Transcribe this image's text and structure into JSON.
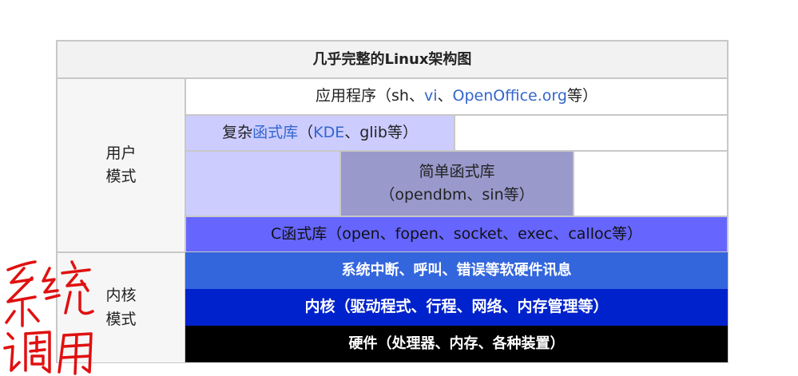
{
  "title": "几乎完整的Linux架构图",
  "user_mode": {
    "line1": "用户",
    "line2": "模式"
  },
  "kernel_mode": {
    "line1": "内核",
    "line2": "模式"
  },
  "apps": {
    "prefix": "应用程序（sh、",
    "vi": "vi",
    "sep": "、",
    "openoffice": "OpenOffice.org",
    "suffix": "等）"
  },
  "complex_lib": {
    "prefix": "复杂",
    "link": "函式库",
    "mid": "（",
    "kde": "KDE",
    "suffix": "、glib等）"
  },
  "simple_lib": {
    "line1": "简单函式库",
    "line2": "（opendbm、sin等）"
  },
  "c_lib": "C函式库（open、fopen、socket、exec、calloc等）",
  "syscall": "系统中断、呼叫、错误等软硬件讯息",
  "kernel": "内核（驱动程式、行程、网络、内存管理等）",
  "hardware": "硬件（处理器、内存、各种装置）",
  "colors": {
    "complex_bg": "#ccccff",
    "simple_bg": "#9999cc",
    "clib_bg": "#6666ff",
    "syscall_bg": "#3366dd",
    "kernel_bg": "#0022cc",
    "hardware_bg": "#000000",
    "link": "#3366cc",
    "handwriting": "#e01010"
  }
}
